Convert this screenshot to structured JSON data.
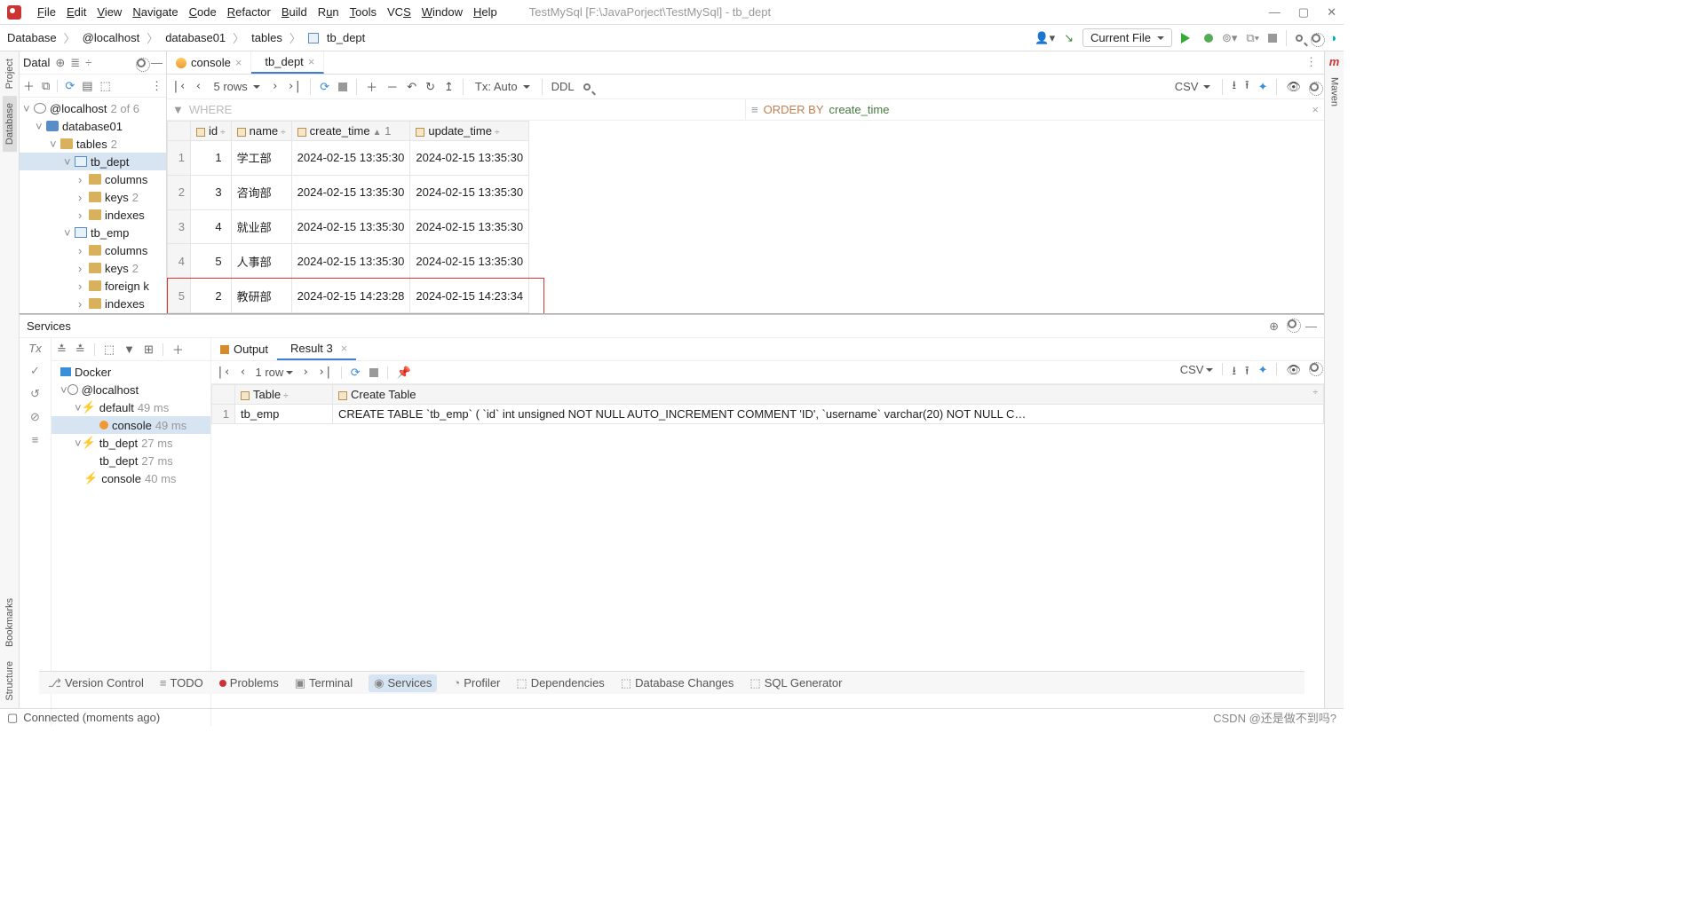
{
  "window": {
    "title": "TestMySql [F:\\JavaPorject\\TestMySql] - tb_dept"
  },
  "menu": [
    "File",
    "Edit",
    "View",
    "Navigate",
    "Code",
    "Refactor",
    "Build",
    "Run",
    "Tools",
    "VCS",
    "Window",
    "Help"
  ],
  "breadcrumb": [
    "Database",
    "@localhost",
    "database01",
    "tables",
    "tb_dept"
  ],
  "runconfig": {
    "scope": "Current File"
  },
  "db_panel": {
    "title": "Datal",
    "root": "@localhost",
    "root_info": "2 of 6",
    "schema": "database01",
    "tables_label": "tables",
    "tables_count": "2",
    "table1": "tb_dept",
    "table2": "tb_emp",
    "cols_label": "columns",
    "keys_label": "keys",
    "keys_count": "2",
    "idx_label": "indexes",
    "fk_label": "foreign k"
  },
  "tabs": {
    "t1": "console",
    "t2": "tb_dept"
  },
  "editor_tools": {
    "rows": "5 rows",
    "tx": "Tx: Auto",
    "ddl": "DDL",
    "csv": "CSV"
  },
  "filter": {
    "where_ph": "WHERE",
    "orderby_kw": "ORDER BY",
    "orderby_col": "create_time"
  },
  "grid": {
    "columns": [
      "id",
      "name",
      "create_time",
      "update_time"
    ],
    "sort_col_idx": 2,
    "sort_num": "1",
    "rows": [
      {
        "n": 1,
        "id": 1,
        "name": "学工部",
        "ct": "2024-02-15 13:35:30",
        "ut": "2024-02-15 13:35:30"
      },
      {
        "n": 2,
        "id": 3,
        "name": "咨询部",
        "ct": "2024-02-15 13:35:30",
        "ut": "2024-02-15 13:35:30"
      },
      {
        "n": 3,
        "id": 4,
        "name": "就业部",
        "ct": "2024-02-15 13:35:30",
        "ut": "2024-02-15 13:35:30"
      },
      {
        "n": 4,
        "id": 5,
        "name": "人事部",
        "ct": "2024-02-15 13:35:30",
        "ut": "2024-02-15 13:35:30"
      },
      {
        "n": 5,
        "id": 2,
        "name": "教研部",
        "ct": "2024-02-15 14:23:28",
        "ut": "2024-02-15 14:23:34"
      }
    ]
  },
  "services": {
    "title": "Services",
    "tree": {
      "docker": "Docker",
      "host": "@localhost",
      "default": "default",
      "default_ms": "49 ms",
      "console": "console",
      "console_ms": "49 ms",
      "tb_dept": "tb_dept",
      "tb_dept_ms": "27 ms",
      "tb_dept2": "tb_dept",
      "tb_dept2_ms": "27 ms",
      "console2": "console",
      "console2_ms": "40 ms"
    },
    "tabs": {
      "output": "Output",
      "result": "Result 3"
    },
    "tools": {
      "rows": "1 row",
      "csv": "CSV"
    },
    "grid": {
      "columns": [
        "Table",
        "Create Table"
      ],
      "row": {
        "n": 1,
        "table": "tb_emp",
        "sql": "CREATE TABLE `tb_emp` (   `id` int unsigned NOT NULL AUTO_INCREMENT COMMENT 'ID',   `username` varchar(20) NOT NULL C…"
      }
    }
  },
  "bottom_tabs": [
    "Version Control",
    "TODO",
    "Problems",
    "Terminal",
    "Services",
    "Profiler",
    "Dependencies",
    "Database Changes",
    "SQL Generator"
  ],
  "status": {
    "msg": "Connected (moments ago)",
    "watermark": "CSDN @还是做不到吗?"
  },
  "rails": {
    "project": "Project",
    "database": "Database",
    "bookmarks": "Bookmarks",
    "structure": "Structure",
    "maven": "Maven"
  }
}
